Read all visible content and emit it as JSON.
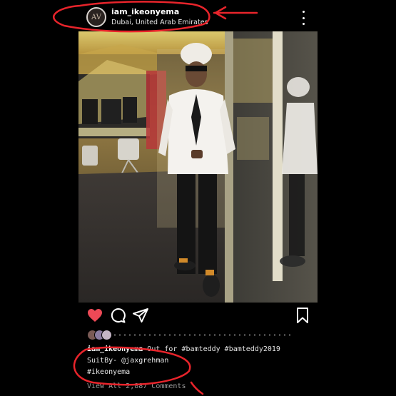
{
  "post": {
    "username": "iam_ikeonyema",
    "location": "Dubai, United Arab Emirates",
    "avatar_mark": "AV"
  },
  "caption": {
    "username": "iam_ikeonyema",
    "line1": " Out for #bamteddy #bamteddy2019",
    "line2": "SuitBy- @jaxgrehman",
    "line3": "#ikeonyema"
  },
  "comments_link": "View All 2,887 Comments",
  "icons": {
    "more": "more-vertical-icon",
    "like": "heart-icon",
    "comment": "comment-icon",
    "share": "send-icon",
    "save": "bookmark-icon"
  },
  "colors": {
    "like_red": "#ed4956",
    "annotation_red": "#e8242b"
  }
}
